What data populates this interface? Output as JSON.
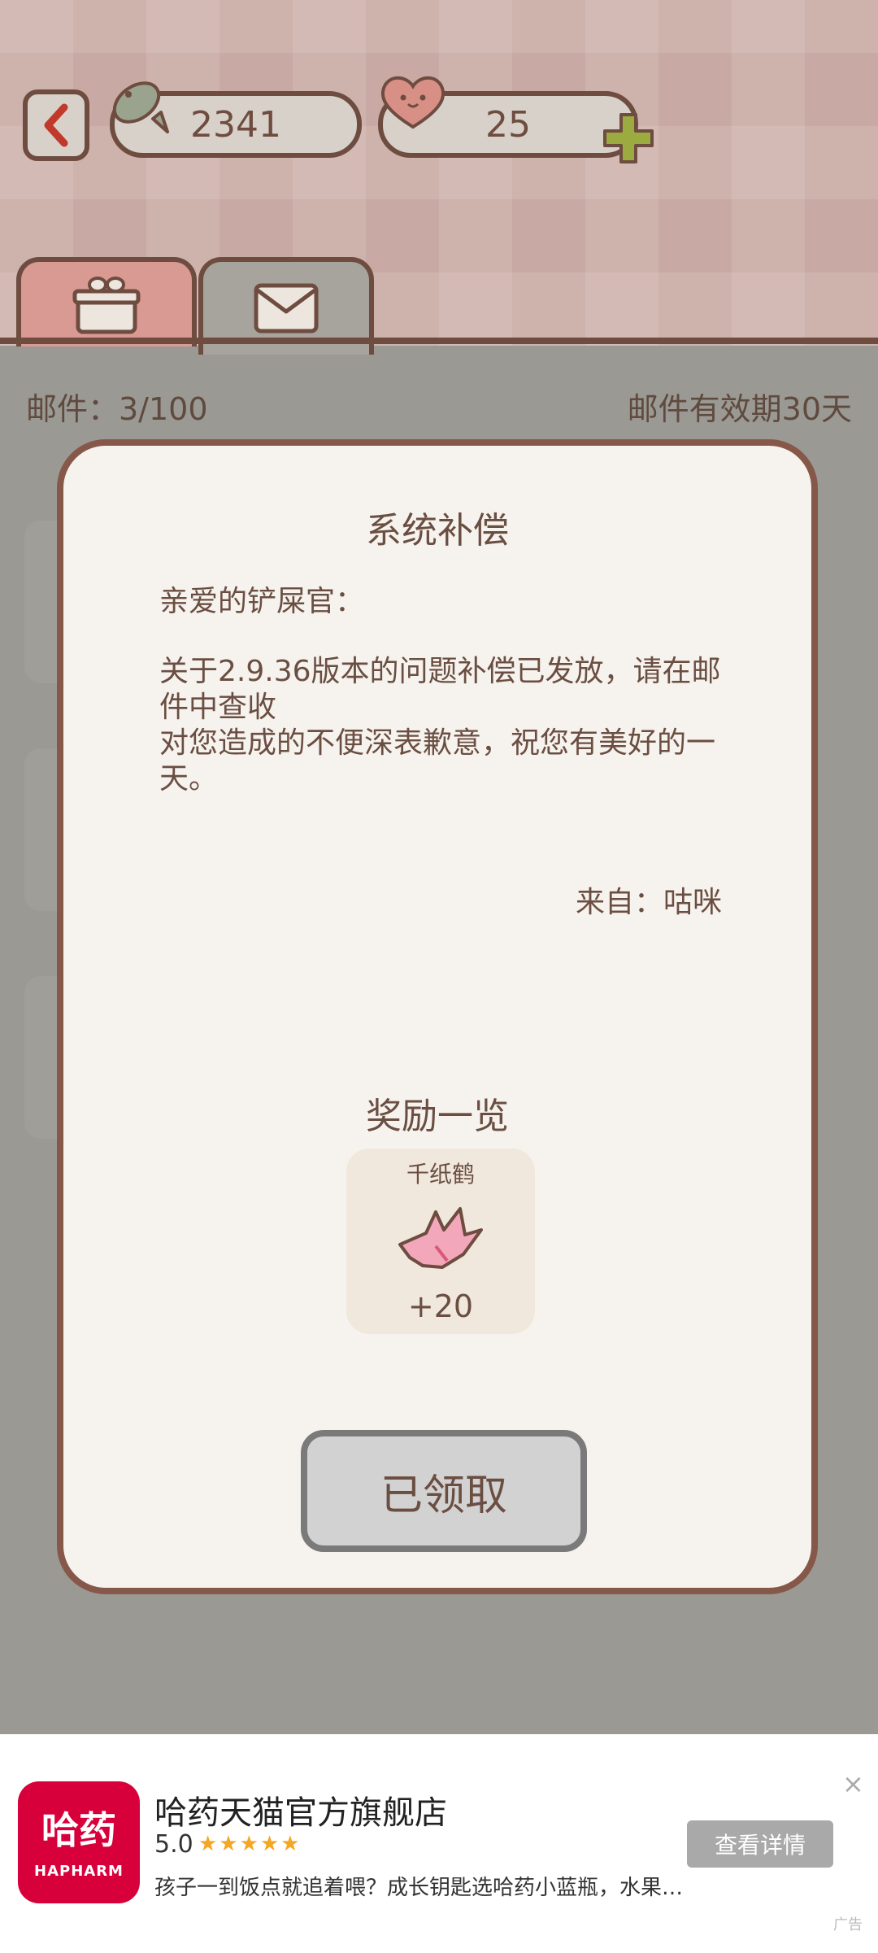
{
  "header": {
    "fish_count": "2341",
    "heart_count": "25"
  },
  "mailbox": {
    "count_label": "邮件：3/100",
    "expiry_label": "邮件有效期30天"
  },
  "mail": {
    "title": "系统补偿",
    "greeting": "亲爱的铲屎官：",
    "body_line1": "关于2.9.36版本的问题补偿已发放，请在邮件中查收",
    "body_line2": "对您造成的不便深表歉意，祝您有美好的一天。",
    "from": "来自：咕咪"
  },
  "rewards": {
    "title": "奖励一览",
    "items": [
      {
        "name": "千纸鹤",
        "qty": "+20",
        "icon": "paper-crane-icon"
      }
    ]
  },
  "claimed_button": "已领取",
  "ad": {
    "logo_cn": "哈药",
    "logo_en": "HAPHARM",
    "title": "哈药天猫官方旗舰店",
    "rating": "5.0",
    "stars": "★★★★★",
    "description": "孩子一到饭点就追着喂？成长钥匙选哈药小蓝瓶，水果…",
    "button": "查看详情",
    "close": "×",
    "label": "广告"
  },
  "colors": {
    "brown": "#6e4c40",
    "modal_bg": "#f6f3ee",
    "ad_red": "#d8003a"
  }
}
